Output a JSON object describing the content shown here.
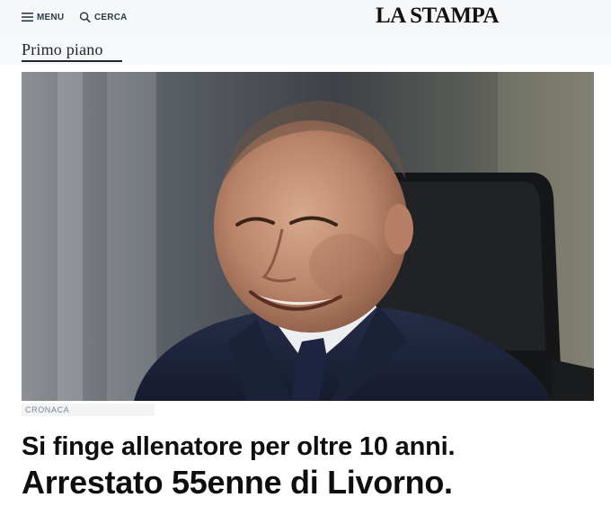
{
  "header": {
    "menu_label": "MENU",
    "search_label": "CERCA",
    "logo_text": "LA STAMPA",
    "icons": [
      "menu-icon",
      "search-icon"
    ]
  },
  "section": {
    "title": "Primo piano"
  },
  "article": {
    "category": "CRONACA",
    "headline_line1": "Si finge allenatore per oltre 10 anni.",
    "headline_line2": "Arrestato 55enne di Livorno."
  },
  "colors": {
    "text_dark": "#0e0e0e",
    "nav_text": "#2b3a4a",
    "category_text": "#7c8894",
    "topbar_bg": "#f6f7f8"
  }
}
